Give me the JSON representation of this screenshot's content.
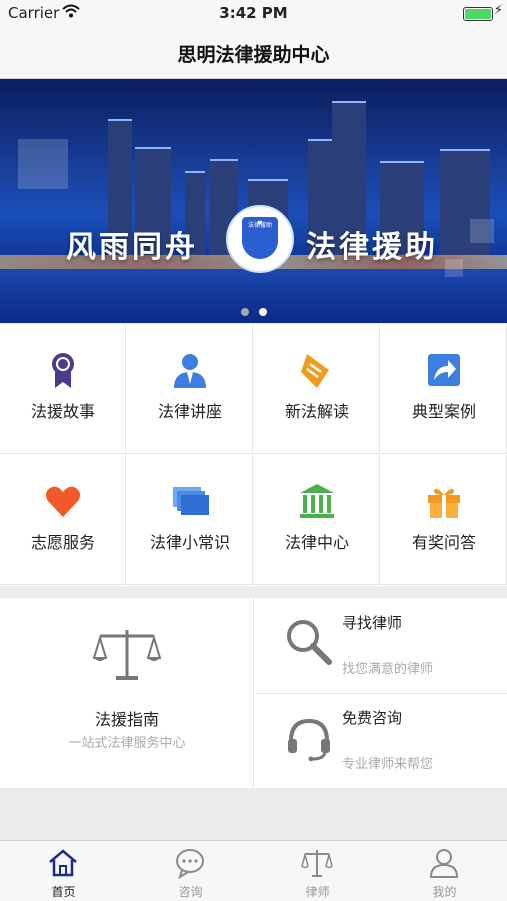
{
  "status_bar": {
    "carrier": "Carrier",
    "time": "3:42 PM"
  },
  "nav": {
    "title": "思明法律援助中心"
  },
  "banner": {
    "left_text": "风雨同舟",
    "right_text": "法律援助",
    "logo_text": "法律援助",
    "page_count": 2,
    "active_page": 2
  },
  "grid": {
    "items": [
      {
        "label": "法援故事",
        "icon": "medal-icon"
      },
      {
        "label": "法律讲座",
        "icon": "lecturer-icon"
      },
      {
        "label": "新法解读",
        "icon": "scroll-icon"
      },
      {
        "label": "典型案例",
        "icon": "share-arrow-icon"
      },
      {
        "label": "志愿服务",
        "icon": "heart-icon"
      },
      {
        "label": "法律小常识",
        "icon": "cards-icon"
      },
      {
        "label": "法律中心",
        "icon": "courthouse-icon"
      },
      {
        "label": "有奖问答",
        "icon": "gift-icon"
      }
    ]
  },
  "guide": {
    "title": "法援指南",
    "subtitle": "一站式法律服务中心"
  },
  "find_lawyer": {
    "title": "寻找律师",
    "subtitle": "找您满意的律师"
  },
  "free_consult": {
    "title": "免费咨询",
    "subtitle": "专业律师来帮您"
  },
  "tabs": [
    {
      "label": "首页",
      "icon": "home-icon",
      "active": true
    },
    {
      "label": "咨询",
      "icon": "chat-icon",
      "active": false
    },
    {
      "label": "律师",
      "icon": "scales-icon",
      "active": false
    },
    {
      "label": "我的",
      "icon": "profile-icon",
      "active": false
    }
  ],
  "colors": {
    "accent": "#1d2a8a",
    "banner_blue": "#1a4fb8",
    "orange": "#f39a1e",
    "red": "#f05a28",
    "green": "#4caf50",
    "blue": "#3d7fe0",
    "purple": "#4a3c8c"
  }
}
